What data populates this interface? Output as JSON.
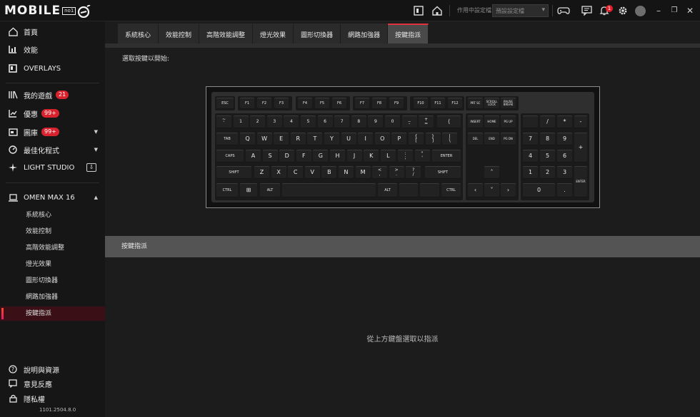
{
  "titlebar": {
    "logo_text": "MOBILE",
    "logo_tag": "no1",
    "profile_label": "作用中設定檔",
    "profile_value": "預設設定檔",
    "notification_count": "1"
  },
  "sidebar": {
    "items": [
      {
        "label": "首頁",
        "icon": "home-icon"
      },
      {
        "label": "效能",
        "icon": "performance-chart-icon"
      },
      {
        "label": "OVERLAYS",
        "icon": "overlays-icon"
      },
      {
        "label": "我的遊戲",
        "icon": "library-icon",
        "badge": "21"
      },
      {
        "label": "優惠",
        "icon": "trend-icon",
        "badge": "99+"
      },
      {
        "label": "圖庫",
        "icon": "gallery-icon",
        "badge": "99+"
      },
      {
        "label": "最佳化程式",
        "icon": "optimizer-icon"
      },
      {
        "label": "LIGHT STUDIO",
        "icon": "sparkle-icon"
      }
    ],
    "device": "OMEN MAX 16",
    "sub_items": [
      "系統核心",
      "效能控制",
      "高階效能調整",
      "燈光效果",
      "圖形切換器",
      "網路加強器",
      "按鍵指派"
    ],
    "footer": [
      {
        "label": "說明與資源",
        "icon": "help-icon"
      },
      {
        "label": "意見反應",
        "icon": "feedback-icon"
      },
      {
        "label": "隱私權",
        "icon": "lock-icon"
      }
    ],
    "version": "1101.2504.8.0"
  },
  "tabs": [
    "系統核心",
    "效能控制",
    "高階效能調整",
    "燈光效果",
    "圖形切換器",
    "網路加強器",
    "按鍵指派"
  ],
  "active_tab": "按鍵指派",
  "main": {
    "prompt": "選取按鍵以開始:",
    "assign_title": "按鍵指派",
    "empty_message": "從上方鍵盤選取以指派"
  },
  "keyboard": {
    "esc": "ESC",
    "f_row": [
      "F1",
      "F2",
      "F3",
      "F4",
      "F5",
      "F6",
      "F7",
      "F8",
      "F9",
      "F10",
      "F11",
      "F12"
    ],
    "sys_keys": [
      "PRT SC",
      "SCROLL LOCK",
      "PAUSE BREAK"
    ],
    "number_row": [
      [
        "~",
        "`"
      ],
      [
        "",
        "1"
      ],
      [
        "",
        "2"
      ],
      [
        "",
        "3"
      ],
      [
        "",
        "4"
      ],
      [
        "",
        "5"
      ],
      [
        "",
        "6"
      ],
      [
        "",
        "7"
      ],
      [
        "",
        "8"
      ],
      [
        "",
        "9"
      ],
      [
        "",
        "0"
      ],
      [
        "_",
        "-"
      ],
      [
        "+",
        "="
      ]
    ],
    "backspace": "⟨",
    "tab": "TAB",
    "q_row": [
      "Q",
      "W",
      "E",
      "R",
      "T",
      "Y",
      "U",
      "I",
      "O",
      "P"
    ],
    "q_row_brackets": [
      [
        "{",
        "["
      ],
      [
        "}",
        "]"
      ],
      [
        "|",
        "\\"
      ]
    ],
    "caps": "CAPS",
    "a_row": [
      "A",
      "S",
      "D",
      "F",
      "G",
      "H",
      "J",
      "K",
      "L"
    ],
    "a_row_punct": [
      [
        ":",
        ";"
      ],
      [
        "\"",
        "'"
      ]
    ],
    "enter": "ENTER",
    "shift": "SHIFT",
    "z_row": [
      "Z",
      "X",
      "C",
      "V",
      "B",
      "N",
      "M"
    ],
    "z_row_punct": [
      [
        "<",
        ","
      ],
      [
        ">",
        "."
      ],
      [
        "?",
        "/"
      ]
    ],
    "ctrl": "CTRL",
    "alt": "ALT",
    "nav_keys": [
      "INSERT",
      "HOME",
      "PG UP",
      "DEL",
      "END",
      "PG DN"
    ],
    "numpad": {
      "row1": [
        "",
        "/",
        "*",
        "-"
      ],
      "row2": [
        "7",
        "8",
        "9",
        "+"
      ],
      "row3": [
        "4",
        "5",
        "6"
      ],
      "row4": [
        "1",
        "2",
        "3",
        "ENTER"
      ],
      "row5": [
        "0",
        "."
      ]
    }
  }
}
